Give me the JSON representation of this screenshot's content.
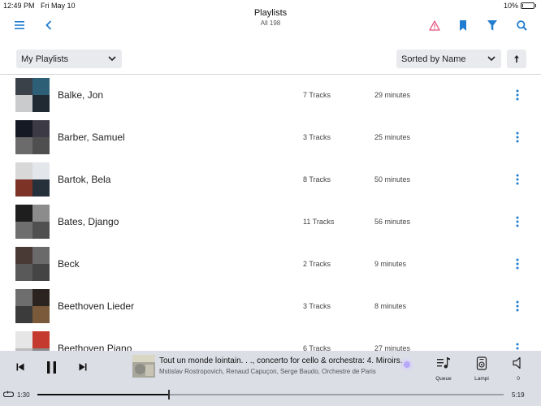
{
  "status": {
    "time": "12:49 PM",
    "date": "Fri May 10",
    "battery": "10%",
    "battery_level": 0.1
  },
  "nav": {
    "title": "Playlists",
    "subtitle": "All 198",
    "icons": [
      "menu-icon",
      "back-chevron-icon",
      "warning-icon",
      "bookmark-icon",
      "filter-icon",
      "search-icon"
    ]
  },
  "filters": {
    "source": "My Playlists",
    "sort": "Sorted by Name"
  },
  "playlists": [
    {
      "name": "Balke, Jon",
      "tracks": "7 Tracks",
      "duration": "29 minutes"
    },
    {
      "name": "Barber, Samuel",
      "tracks": "3 Tracks",
      "duration": "25 minutes"
    },
    {
      "name": "Bartok, Bela",
      "tracks": "8 Tracks",
      "duration": "50 minutes"
    },
    {
      "name": "Bates, Django",
      "tracks": "11 Tracks",
      "duration": "56 minutes"
    },
    {
      "name": "Beck",
      "tracks": "2 Tracks",
      "duration": "9 minutes"
    },
    {
      "name": "Beethoven Lieder",
      "tracks": "3 Tracks",
      "duration": "8 minutes"
    },
    {
      "name": "Beethoven Piano",
      "tracks": "6 Tracks",
      "duration": "27 minutes"
    }
  ],
  "player": {
    "title": "Tout un monde lointain. . ., concerto for cello & orchestra: 4. Miroirs.",
    "artist": "Mstislav Rostropovich, Renaud Capuçon, Serge Baudo, Orchestre de Paris",
    "elapsed": "1:30",
    "total": "5:19",
    "progress": 0.282,
    "queue_label": "Queue",
    "zone_label": "Lampi",
    "volume_label": "0"
  },
  "colors": {
    "accent": "#1f7ccf",
    "warning": "#e2507a",
    "player_bg": "#dcdee6"
  }
}
